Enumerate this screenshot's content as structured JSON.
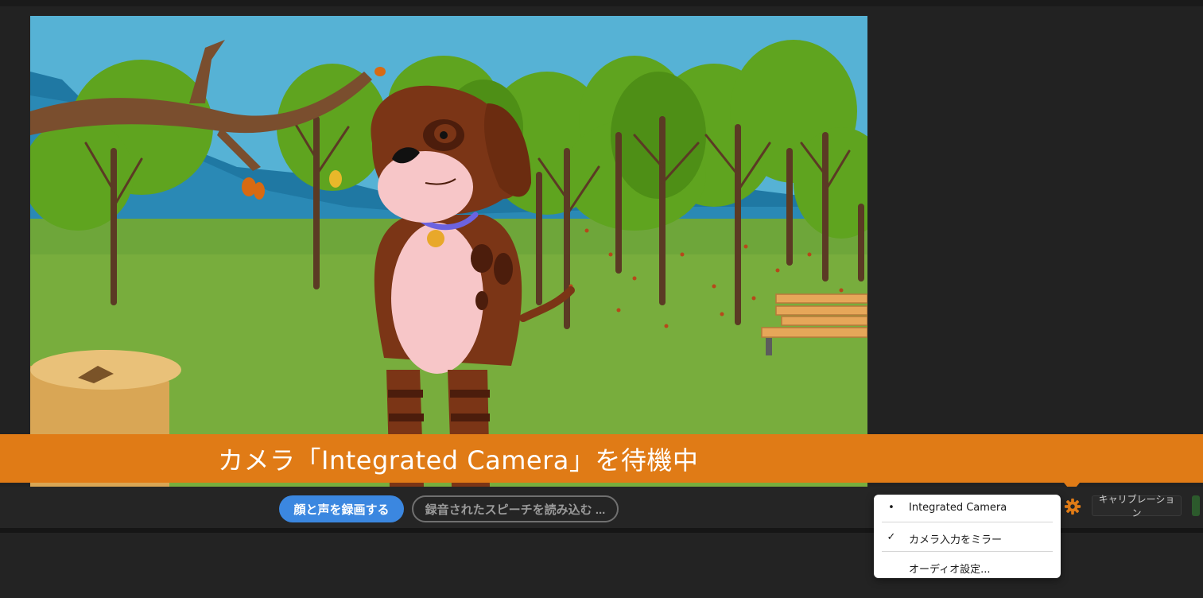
{
  "banner": {
    "status_text": "カメラ「Integrated Camera」を待機中"
  },
  "controls": {
    "record_button": "顔と声を録画する",
    "load_speech_button": "録音されたスピーチを読み込む ...",
    "calibration_button": "キャリブレーション",
    "settings_icon": "gear-icon"
  },
  "menu": {
    "items": [
      {
        "label": "Integrated Camera",
        "mark": "•"
      },
      {
        "label": "カメラ入力をミラー",
        "mark": "✓"
      },
      {
        "label": "オーディオ設定...",
        "mark": ""
      }
    ]
  },
  "colors": {
    "banner": "#e07b16",
    "primary_button": "#3b87e0",
    "background": "#222222"
  }
}
